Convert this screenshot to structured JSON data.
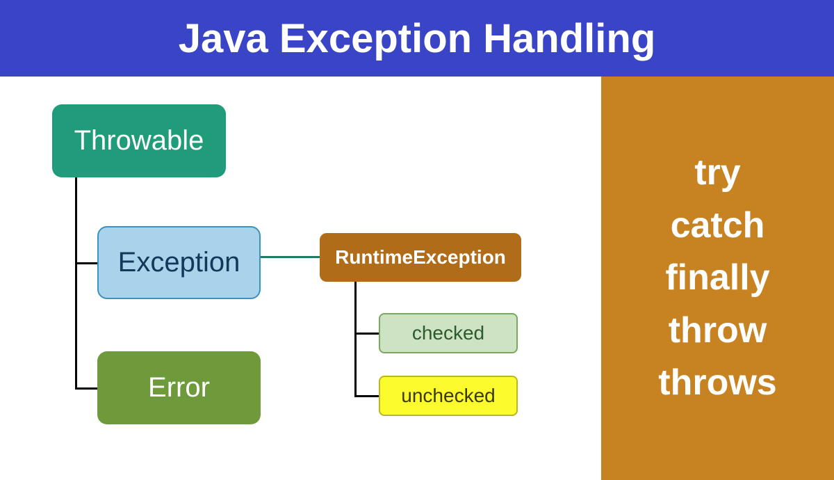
{
  "banner": {
    "title": "Java Exception Handling"
  },
  "sidebar": {
    "items": [
      "try",
      "catch",
      "finally",
      "throw",
      "throws"
    ]
  },
  "diagram": {
    "nodes": {
      "throwable": "Throwable",
      "exception": "Exception",
      "error": "Error",
      "runtime": "RuntimeException",
      "checked": "checked",
      "unchecked": "unchecked"
    }
  }
}
